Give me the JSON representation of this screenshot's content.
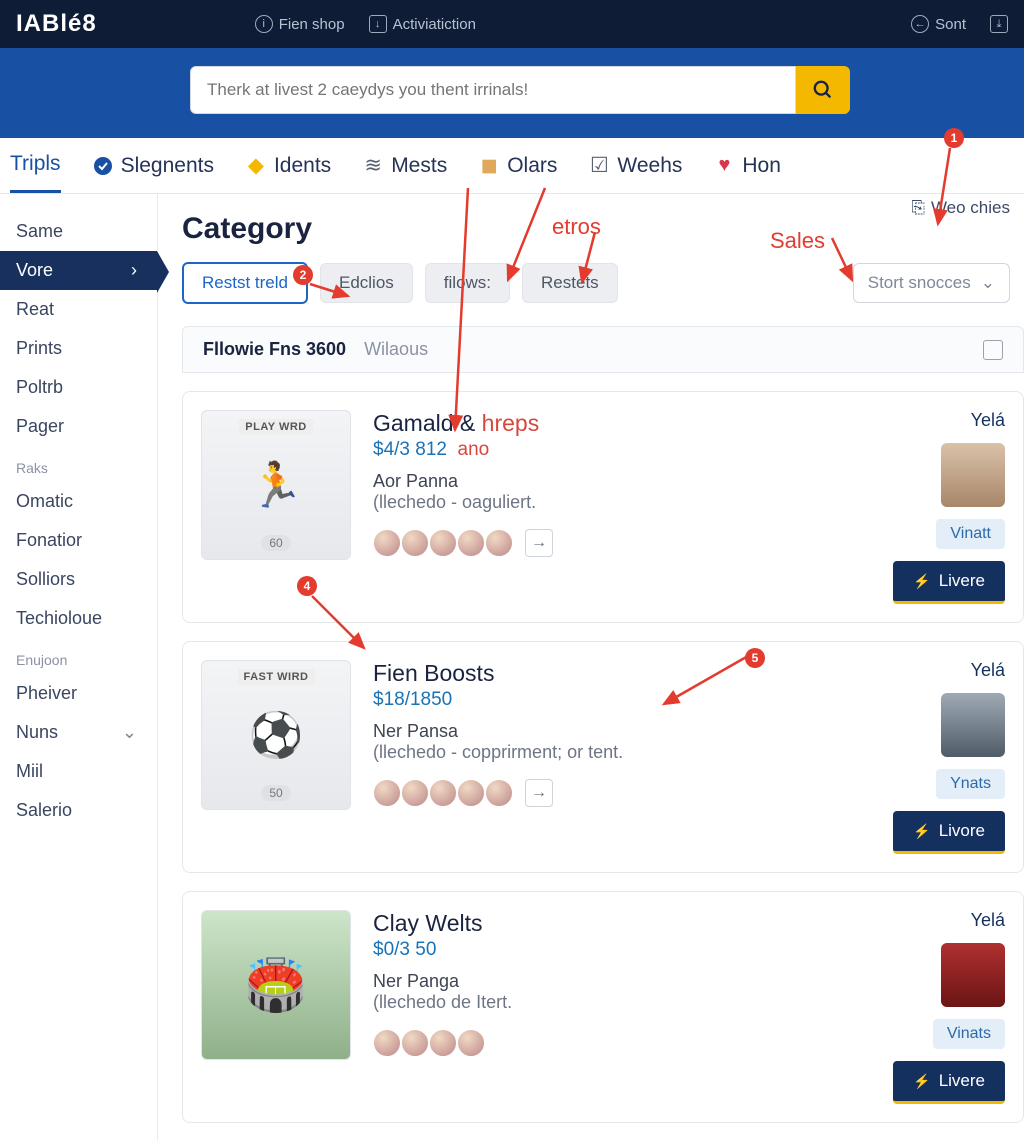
{
  "topbar": {
    "logo": "IABlé8",
    "link1": "Fien shop",
    "link2": "Activiatiction",
    "sort_label": "Sont"
  },
  "search": {
    "placeholder": "Therk at livest 2 caeydys you thent irrinals!"
  },
  "tabs": [
    {
      "label": "Tripls",
      "icon": "tab-icon-triples"
    },
    {
      "label": "Slegnents",
      "icon": "check-circle-icon"
    },
    {
      "label": "Idents",
      "icon": "bulb-icon"
    },
    {
      "label": "Mests",
      "icon": "chart-icon"
    },
    {
      "label": "Olars",
      "icon": "square-icon"
    },
    {
      "label": "Weehs",
      "icon": "list-icon"
    },
    {
      "label": "Hon",
      "icon": "heart-icon"
    }
  ],
  "sidebar": {
    "top": [
      "Same"
    ],
    "active": "Vore",
    "group1": [
      "Reat",
      "Prints",
      "Poltrb",
      "Pager"
    ],
    "group1_label": "Raks",
    "group2": [
      "Omatic",
      "Fonatior",
      "Solliors",
      "Techioloue"
    ],
    "group2_label": "Enujoon",
    "group3": [
      "Pheiver",
      "Nuns",
      "Miil",
      "Salerio"
    ]
  },
  "category": {
    "title": "Category",
    "chips": [
      "Restst treld",
      "Edclios",
      "filows:",
      "Restets"
    ],
    "sort_placeholder": "Stort snocces",
    "toplink": "Weo chies"
  },
  "results_header": {
    "count": "Fllowie Fns 3600",
    "sub": "Wilaous"
  },
  "cards": [
    {
      "thumb_tag": "PLAY WRD",
      "thumb_num": "60",
      "title_a": "Gamald & ",
      "title_b": "hreps",
      "price_a": "$4/3 812",
      "price_b": "ano",
      "meta1": "Aor Panna",
      "meta2": "(llechedo - oaguliert.",
      "badge_y": "Yelá",
      "badge_v": "Vinatt",
      "cta": "Livere"
    },
    {
      "thumb_tag": "FAST WIRD",
      "thumb_num": "50",
      "title_a": "Fien Boosts",
      "title_b": "",
      "price_a": "$18/1850",
      "price_b": "",
      "meta1": "Ner Pansa",
      "meta2": "(llechedo - copprirment; or tent.",
      "badge_y": "Yelá",
      "badge_v": "Ynats",
      "cta": "Livore"
    },
    {
      "thumb_tag": "",
      "thumb_num": "",
      "title_a": "Clay Welts",
      "title_b": "",
      "price_a": "$0/3 50",
      "price_b": "",
      "meta1": "Ner Panga",
      "meta2": "(llechedo de Itert.",
      "badge_y": "Yelá",
      "badge_v": "Vinats",
      "cta": "Livere"
    }
  ],
  "annotations": {
    "label_etros": "etros",
    "label_sales": "Sales",
    "dots": [
      "1",
      "2",
      "4",
      "5"
    ]
  }
}
